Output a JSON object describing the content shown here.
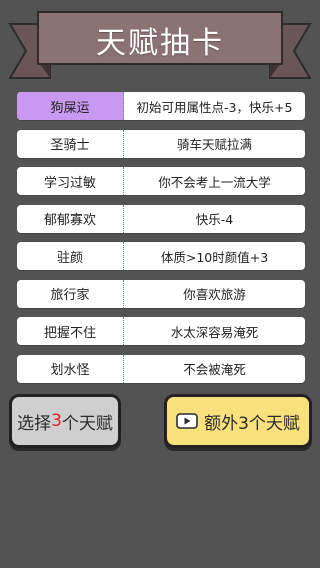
{
  "banner": {
    "title": "天赋抽卡"
  },
  "talents": [
    {
      "name": "狗屎运",
      "desc": "初始可用属性点-3，快乐+5",
      "selected": true
    },
    {
      "name": "圣骑士",
      "desc": "骑车天赋拉满",
      "selected": false
    },
    {
      "name": "学习过敏",
      "desc": "你不会考上一流大学",
      "selected": false
    },
    {
      "name": "郁郁寡欢",
      "desc": "快乐-4",
      "selected": false
    },
    {
      "name": "驻颜",
      "desc": "体质>10时颜值+3",
      "selected": false
    },
    {
      "name": "旅行家",
      "desc": "你喜欢旅游",
      "selected": false
    },
    {
      "name": "把握不住",
      "desc": "水太深容易淹死",
      "selected": false
    },
    {
      "name": "划水怪",
      "desc": "不会被淹死",
      "selected": false
    }
  ],
  "buttons": {
    "select_prefix": "选择",
    "select_count": "3",
    "select_suffix": "个天赋",
    "extra_label": "额外3个天赋",
    "extra_icon": "video-play-icon"
  },
  "colors": {
    "background": "#535353",
    "banner": "#8b7274",
    "selected": "#c999f0",
    "extra_button": "#f8e07d",
    "select_button": "#cfcfcf",
    "count_highlight": "#e0242a"
  }
}
